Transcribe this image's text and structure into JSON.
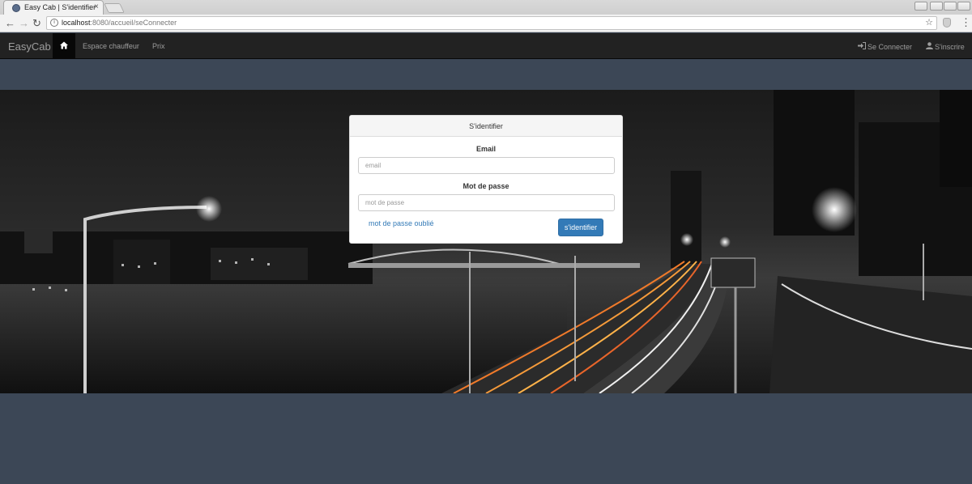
{
  "browser": {
    "tab_title": "Easy Cab | S'identifier",
    "tab_close": "×",
    "url_host": "localhost",
    "url_path": ":8080/accueil/seConnecter",
    "info_icon": "i",
    "star_icon": "☆",
    "menu_icon": "⋮",
    "back_icon": "←",
    "forward_icon": "→",
    "reload_icon": "↻"
  },
  "navbar": {
    "brand": "EasyCab",
    "links": [
      "Espace chauffeur",
      "Prix"
    ],
    "login_label": "Se Connecter",
    "signup_label": "S'inscrire"
  },
  "login": {
    "heading": "S'identifier",
    "email_label": "Email",
    "email_placeholder": "email",
    "password_label": "Mot de passe",
    "password_placeholder": "mot de passe",
    "forgot_label": "mot de passe oublié",
    "submit_label": "s'identifier"
  },
  "colors": {
    "navbar_bg": "#222222",
    "page_bg": "#3c4756",
    "primary": "#337ab7",
    "link": "#337ab7"
  }
}
